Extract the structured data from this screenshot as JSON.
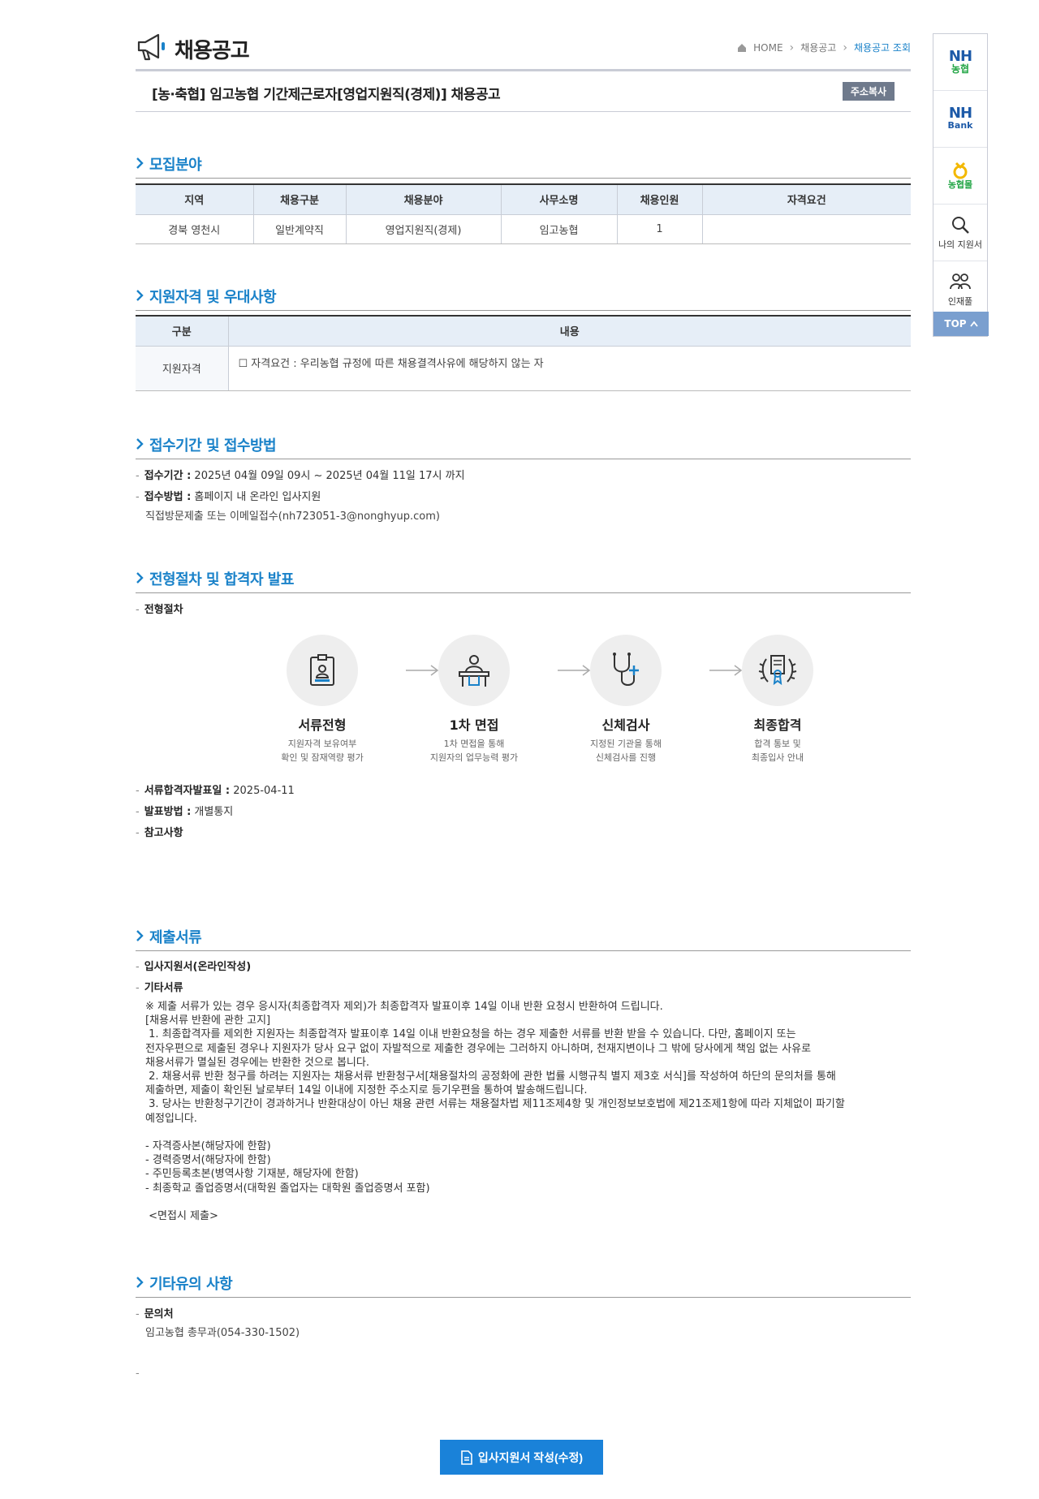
{
  "header": {
    "title": "채용공고",
    "breadcrumb": {
      "home": "HOME",
      "level1": "채용공고",
      "current": "채용공고 조회"
    }
  },
  "posting": {
    "title": "[농·축협] 임고농협 기간제근로자[영업지원직(경제)] 채용공고",
    "copy_button": "주소복사"
  },
  "recruit": {
    "section_title": "모집분야",
    "headers": [
      "지역",
      "채용구분",
      "채용분야",
      "사무소명",
      "채용인원",
      "자격요건"
    ],
    "row": [
      "경북 영천시",
      "일반계약직",
      "영업지원직(경제)",
      "임고농협",
      "1",
      ""
    ]
  },
  "qualification": {
    "section_title": "지원자격 및 우대사항",
    "headers": [
      "구분",
      "내용"
    ],
    "label": "지원자격",
    "content": "☐ 자격요건 : 우리농협 규정에 따른 채용결격사유에 해당하지 않는 자"
  },
  "reception": {
    "section_title": "접수기간 및 접수방법",
    "period_label": "접수기간 :",
    "period_value": "2025년 04월 09일 09시 ~ 2025년 04월 11일 17시 까지",
    "method_label": "접수방법 :",
    "method_value": "홈페이지 내 온라인 입사지원",
    "method_extra": "직접방문제출 또는 이메일접수(nh723051-3@nonghyup.com)"
  },
  "process": {
    "section_title": "전형절차 및 합격자 발표",
    "label": "전형절차",
    "steps": [
      {
        "name": "서류전형",
        "desc1": "지원자격 보유여부",
        "desc2": "확인 및 잠재역량 평가"
      },
      {
        "name": "1차 면접",
        "desc1": "1차 면접을 통해",
        "desc2": "지원자의 업무능력 평가"
      },
      {
        "name": "신체검사",
        "desc1": "지정된 기관을 통해",
        "desc2": "신체검사를 진행"
      },
      {
        "name": "최종합격",
        "desc1": "합격 통보 및",
        "desc2": "최종입사 안내"
      }
    ],
    "doc_pass_label": "서류합격자발표일 :",
    "doc_pass_value": "2025-04-11",
    "announce_label": "발표방법 :",
    "announce_value": "개별통지",
    "note_label": "참고사항"
  },
  "documents": {
    "section_title": "제출서류",
    "item1": "입사지원서(온라인작성)",
    "item2": "기타서류",
    "text": "※ 제출 서류가 있는 경우 응시자(최종합격자 제외)가 최종합격자 발표이후 14일 이내 반환 요청시 반환하여 드립니다.\n[채용서류 반환에 관한 고지]\n 1. 최종합격자를 제외한 지원자는 최종합격자 발표이후 14일 이내 반환요청을 하는 경우 제출한 서류를 반환 받을 수 있습니다. 다만, 홈페이지 또는\n전자우편으로 제출된 경우나 지원자가 당사 요구 없이 자발적으로 제출한 경우에는 그러하지 아니하며, 천재지변이나 그 밖에 당사에게 책임 없는 사유로\n채용서류가 멸실된 경우에는 반환한 것으로 봅니다.\n 2. 채용서류 반환 청구를 하려는 지원자는 채용서류 반환청구서[채용절차의 공정화에 관한 법률 시행규칙 별지 제3호 서식]를 작성하여 하단의 문의처를 통해\n제출하면, 제출이 확인된 날로부터 14일 이내에 지정한 주소지로 등기우편을 통하여 발송해드립니다.\n 3. 당사는 반환청구기간이 경과하거나 반환대상이 아닌 채용 관련 서류는 채용절차법 제11조제4항 및 개인정보보호법에 제21조제1항에 따라 지체없이 파기할\n예정입니다.\n\n- 자격증사본(해당자에 한함)\n- 경력증명서(해당자에 한함)\n- 주민등록초본(병역사항 기재분, 해당자에 한함)\n- 최종학교 졸업증명서(대학원 졸업자는 대학원 졸업증명서 포함)\n\n <면접시 제출>"
  },
  "etc": {
    "section_title": "기타유의 사항",
    "contact_label": "문의처",
    "contact_value": "임고농협 총무과(054-330-1502)",
    "trailing_dash": "-"
  },
  "apply_button": "입사지원서 작성(수정)",
  "quick": {
    "nh1_top": "NH",
    "nh1_sub": "농협",
    "nh2_top": "NH",
    "nh2_sub": "Bank",
    "mall": "농협몰",
    "my_apply": "나의 지원서",
    "talent": "인재풀",
    "top": "TOP"
  },
  "colors": {
    "accent": "#1a82c9",
    "button": "#1a82d9",
    "top_button": "#7a9fcf"
  }
}
